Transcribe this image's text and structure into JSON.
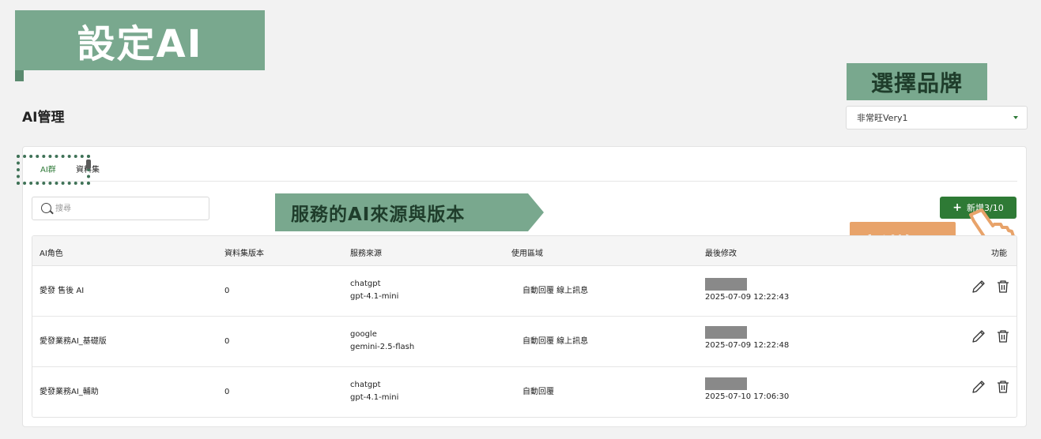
{
  "page_title": "設定AI",
  "brand": {
    "label": "選擇品牌",
    "selected": "非常旺Very1"
  },
  "heading": "AI管理",
  "tabs": [
    {
      "label": "AI群",
      "active": true
    },
    {
      "label": "資料集",
      "active": false
    }
  ],
  "search": {
    "placeholder": "搜尋"
  },
  "annotations": {
    "service": "服務的AI來源與版本",
    "add_ai": "新增AI"
  },
  "add_button": {
    "label": "新增3/10"
  },
  "table": {
    "headers": [
      "AI角色",
      "資料集版本",
      "服務來源",
      "使用區域",
      "最後修改",
      "功能"
    ],
    "rows": [
      {
        "role": "愛發 售後 AI",
        "dataset_version": "0",
        "service_provider": "chatgpt",
        "service_model": "gpt-4.1-mini",
        "region": "自動回覆  線上訊息",
        "modified_at": "2025-07-09 12:22:43"
      },
      {
        "role": "愛發業務AI_基礎版",
        "dataset_version": "0",
        "service_provider": "google",
        "service_model": "gemini-2.5-flash",
        "region": "自動回覆  線上訊息",
        "modified_at": "2025-07-09 12:22:48"
      },
      {
        "role": "愛發業務AI_輔助",
        "dataset_version": "0",
        "service_provider": "chatgpt",
        "service_model": "gpt-4.1-mini",
        "region": "自動回覆",
        "modified_at": "2025-07-10 17:06:30"
      }
    ]
  },
  "colors": {
    "brand_green": "#2e7a35",
    "annotation_green": "#79a88e",
    "annotation_orange": "#e8a36a"
  },
  "icons": [
    "search-icon",
    "plus-icon",
    "pointing-hand-icon",
    "edit-pencil-icon",
    "trash-icon",
    "chevron-down-icon"
  ]
}
